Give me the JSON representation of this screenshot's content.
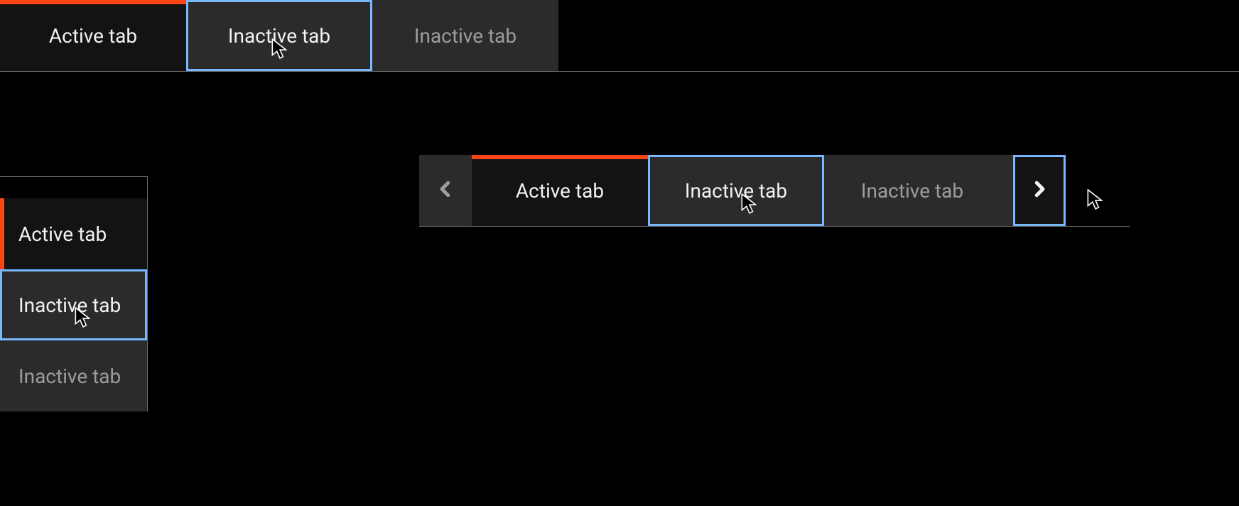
{
  "colors": {
    "accent": "#fa4616",
    "focus_ring": "#79b8ff"
  },
  "top_tabs": {
    "items": [
      {
        "label": "Active tab",
        "state": "active"
      },
      {
        "label": "Inactive tab",
        "state": "focus"
      },
      {
        "label": "Inactive tab",
        "state": "idle"
      }
    ]
  },
  "vertical_tabs": {
    "items": [
      {
        "label": "Active tab",
        "state": "active"
      },
      {
        "label": "Inactive tab",
        "state": "focus"
      },
      {
        "label": "Inactive tab",
        "state": "idle"
      }
    ]
  },
  "scroll_tabs": {
    "prev_icon": "chevron-left",
    "next_icon": "chevron-right",
    "next_focused": true,
    "items": [
      {
        "label": "Active tab",
        "state": "active"
      },
      {
        "label": "Inactive tab",
        "state": "focus"
      },
      {
        "label": "Inactive tab",
        "state": "idle"
      }
    ]
  }
}
